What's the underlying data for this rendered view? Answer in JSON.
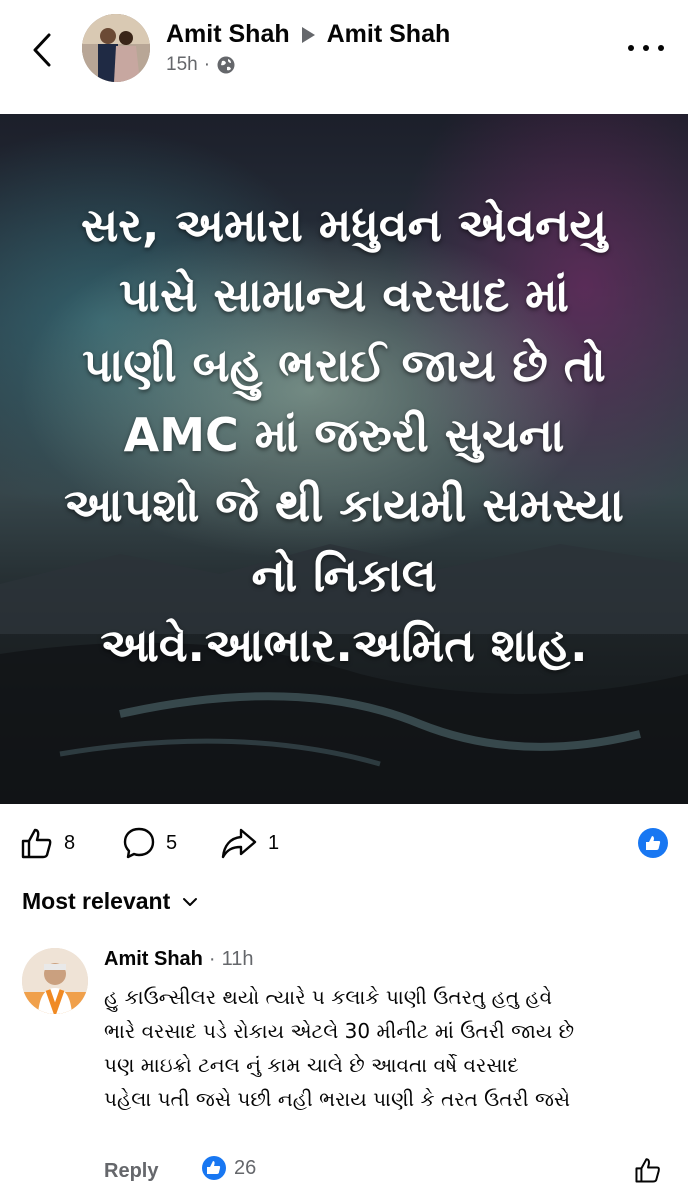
{
  "header": {
    "author": "Amit Shah",
    "target": "Amit Shah",
    "time": "15h",
    "separator": "·"
  },
  "post_image": {
    "lines": [
      "સર, અમારા મધુવન એવનયુ",
      "પાસે સામાન્ય વરસાદ માં",
      "પાણી બહુ ભરાઈ જાય છે તો",
      "AMC માં જરુરી સુચના",
      "આપશો જે થી કાયમી સમસ્યા",
      "નો નિકાલ",
      "આવે.આભાર.અમિત શાહ."
    ]
  },
  "actions": {
    "likes": "8",
    "comments": "5",
    "shares": "1"
  },
  "sort": {
    "label": "Most relevant"
  },
  "comment": {
    "name": "Amit Shah",
    "separator": "·",
    "time": "11h",
    "lines": [
      "હુ કાઉન્સીલર થયો ત્યારે પ કલાકે પાણી ઉતરતુ હતુ હવે",
      "ભારે વરસાદ પડે રોકાય એટલે 30 મીનીટ માં ઉતરી જાય છે",
      "પણ માઇક્રો ટનલ નું કામ ચાલે છે આવતા વર્ષે વરસાદ",
      "પહેલા પતી જસે પછી નહી ભરાય પાણી કે તરત ઉતરી જસે"
    ],
    "reply_label": "Reply",
    "reaction_count": "26"
  },
  "colors": {
    "accent": "#1877f2",
    "muted": "#65676b"
  }
}
